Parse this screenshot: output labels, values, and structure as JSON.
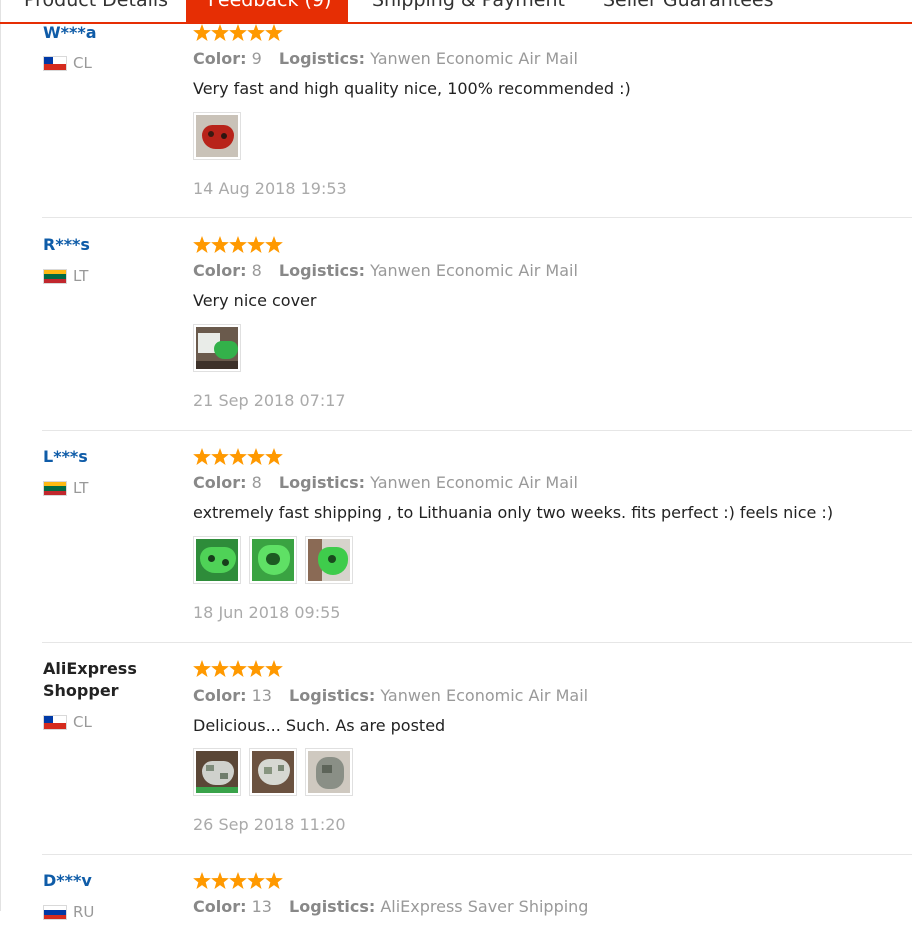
{
  "tabs": [
    {
      "label": "Product Details",
      "active": false
    },
    {
      "label": "Feedback (9)",
      "active": true
    },
    {
      "label": "Shipping & Payment",
      "active": false
    },
    {
      "label": "Seller Guarantees",
      "active": false
    }
  ],
  "colors": {
    "accent": "#e62e04",
    "star": "#ff9900",
    "buyer_link": "#0f5ca8"
  },
  "labels": {
    "color": "Color:",
    "logistics": "Logistics:"
  },
  "reviews": [
    {
      "buyer": "W***a",
      "country": "CL",
      "flag": "chile-flag-icon",
      "rating": 5,
      "color": "9",
      "logistics": "Yanwen Economic Air Mail",
      "comment": "Very fast and high quality nice, 100% recommended :)",
      "photos": [
        "red-controller-photo"
      ],
      "date": "14 Aug 2018 19:53"
    },
    {
      "buyer": "R***s",
      "country": "LT",
      "flag": "lithuania-flag-icon",
      "rating": 5,
      "color": "8",
      "logistics": "Yanwen Economic Air Mail",
      "comment": "Very nice cover",
      "photos": [
        "green-controller-console-photo"
      ],
      "date": "21 Sep 2018 07:17"
    },
    {
      "buyer": "L***s",
      "country": "LT",
      "flag": "lithuania-flag-icon",
      "rating": 5,
      "color": "8",
      "logistics": "Yanwen Economic Air Mail",
      "comment": "extremely fast shipping , to Lithuania only two weeks. fits perfect :) feels nice :)",
      "photos": [
        "green-controller-photo-1",
        "green-controller-photo-2",
        "green-controller-in-hand-photo"
      ],
      "date": "18 Jun 2018 09:55"
    },
    {
      "buyer": "AliExpress Shopper",
      "country": "CL",
      "flag": "chile-flag-icon",
      "rating": 5,
      "color": "13",
      "logistics": "Yanwen Economic Air Mail",
      "comment": "Delicious... Such. As are posted",
      "photos": [
        "camo-controller-photo-1",
        "camo-controller-photo-2",
        "camo-controller-photo-3"
      ],
      "date": "26 Sep 2018 11:20"
    },
    {
      "buyer": "D***v",
      "country": "RU",
      "flag": "russia-flag-icon",
      "rating": 5,
      "color": "13",
      "logistics": "AliExpress Saver Shipping"
    }
  ]
}
